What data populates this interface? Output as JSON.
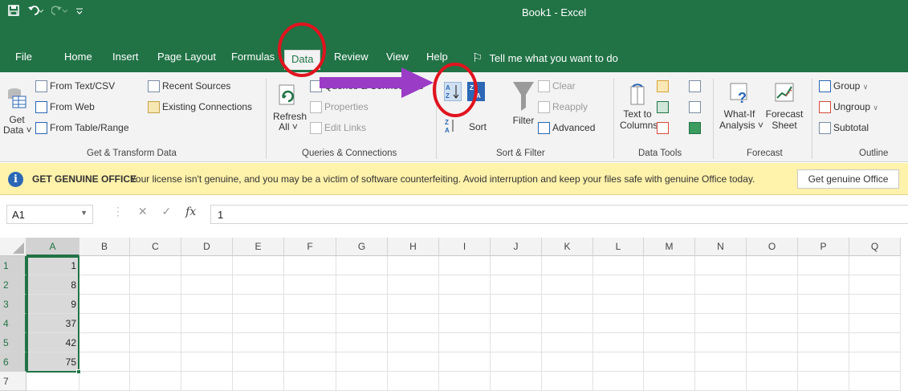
{
  "window": {
    "title": "Book1  -  Excel"
  },
  "qat": {
    "save_icon": "save-icon",
    "undo_icon": "undo-icon",
    "redo_icon": "redo-icon",
    "customize_icon": "customize-qat-icon"
  },
  "tabs": [
    {
      "label": "File"
    },
    {
      "label": "Home"
    },
    {
      "label": "Insert"
    },
    {
      "label": "Page Layout"
    },
    {
      "label": "Formulas"
    },
    {
      "label": "Data"
    },
    {
      "label": "Review"
    },
    {
      "label": "View"
    },
    {
      "label": "Help"
    }
  ],
  "tell_me": "Tell me what you want to do",
  "ribbon": {
    "get_data": {
      "line1": "Get",
      "line2": "Data ˅"
    },
    "from_text_csv": "From Text/CSV",
    "from_web": "From Web",
    "from_table_range": "From Table/Range",
    "recent_sources": "Recent Sources",
    "existing_connections": "Existing Connections",
    "group_get_transform": "Get & Transform Data",
    "refresh": {
      "line1": "Refresh",
      "line2": "All ˅"
    },
    "queries_connections": "Queries & Connections",
    "properties": "Properties",
    "edit_links": "Edit Links",
    "group_queries": "Queries & Connections",
    "sort": "Sort",
    "filter": "Filter",
    "clear": "Clear",
    "reapply": "Reapply",
    "advanced": "Advanced",
    "group_sort_filter": "Sort & Filter",
    "text_to_columns": {
      "line1": "Text to",
      "line2": "Columns"
    },
    "group_data_tools": "Data Tools",
    "what_if": {
      "line1": "What-If",
      "line2": "Analysis ˅"
    },
    "forecast_sheet": {
      "line1": "Forecast",
      "line2": "Sheet"
    },
    "group_forecast": "Forecast",
    "group_btn": "Group",
    "ungroup": "Ungroup",
    "subtotal": "Subtotal",
    "group_outline": "Outline"
  },
  "message_bar": {
    "title": "GET GENUINE OFFICE",
    "text": "Your license isn't genuine, and you may be a victim of software counterfeiting. Avoid interruption and keep your files safe with genuine Office today.",
    "button": "Get genuine Office"
  },
  "formula_bar": {
    "name_box": "A1",
    "fx": "fx",
    "value": "1"
  },
  "columns": [
    "A",
    "B",
    "C",
    "D",
    "E",
    "F",
    "G",
    "H",
    "I",
    "J",
    "K",
    "L",
    "M",
    "N",
    "O",
    "P",
    "Q"
  ],
  "rows": [
    {
      "num": "1",
      "a": "1"
    },
    {
      "num": "2",
      "a": "8"
    },
    {
      "num": "3",
      "a": "9"
    },
    {
      "num": "4",
      "a": "37"
    },
    {
      "num": "5",
      "a": "42"
    },
    {
      "num": "6",
      "a": "75"
    },
    {
      "num": "7",
      "a": ""
    }
  ],
  "annotations": {
    "circle_color": "#e0141e",
    "arrow_color": "#9b3cc7"
  }
}
